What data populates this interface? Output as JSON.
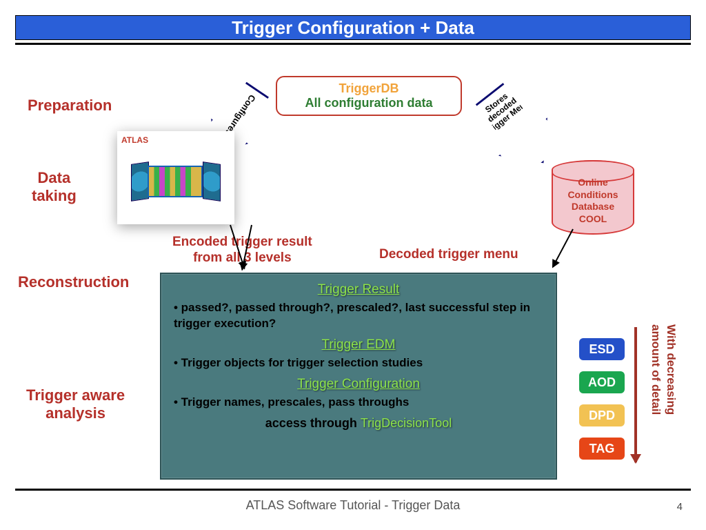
{
  "title": "Trigger Configuration + Data",
  "stages": {
    "preparation": "Preparation",
    "dataTaking": "Data\ntaking",
    "reconstruction": "Reconstruction",
    "triggerAware": "Trigger aware\nanalysis"
  },
  "triggerdb": {
    "line1": "TriggerDB",
    "line2": "All configuration data"
  },
  "arrows": {
    "configures": "Configures",
    "stores": "Stores decoded Trigger Menu"
  },
  "cool": "Online\nConditions\nDatabase\nCOOL",
  "midLabels": {
    "encoded": "Encoded trigger result\nfrom all 3 levels",
    "decoded": "Decoded trigger menu"
  },
  "panel": {
    "h1": "Trigger Result",
    "b1": "• passed?, passed through?,  prescaled?, last successful step in trigger execution?",
    "h2": "Trigger EDM",
    "b2": "• Trigger objects for trigger selection studies",
    "h3": "Trigger Configuration",
    "b3": "• Trigger names, prescales, pass throughs",
    "accessPrefix": "access through ",
    "accessTool": "TrigDecisionTool"
  },
  "formats": {
    "esd": "ESD",
    "aod": "AOD",
    "dpd": "DPD",
    "tag": "TAG"
  },
  "sideText": "With decreasing\namount of detail",
  "detector": {
    "label": "ATLAS"
  },
  "footer": "ATLAS Software Tutorial - Trigger Data",
  "pageNum": "4"
}
